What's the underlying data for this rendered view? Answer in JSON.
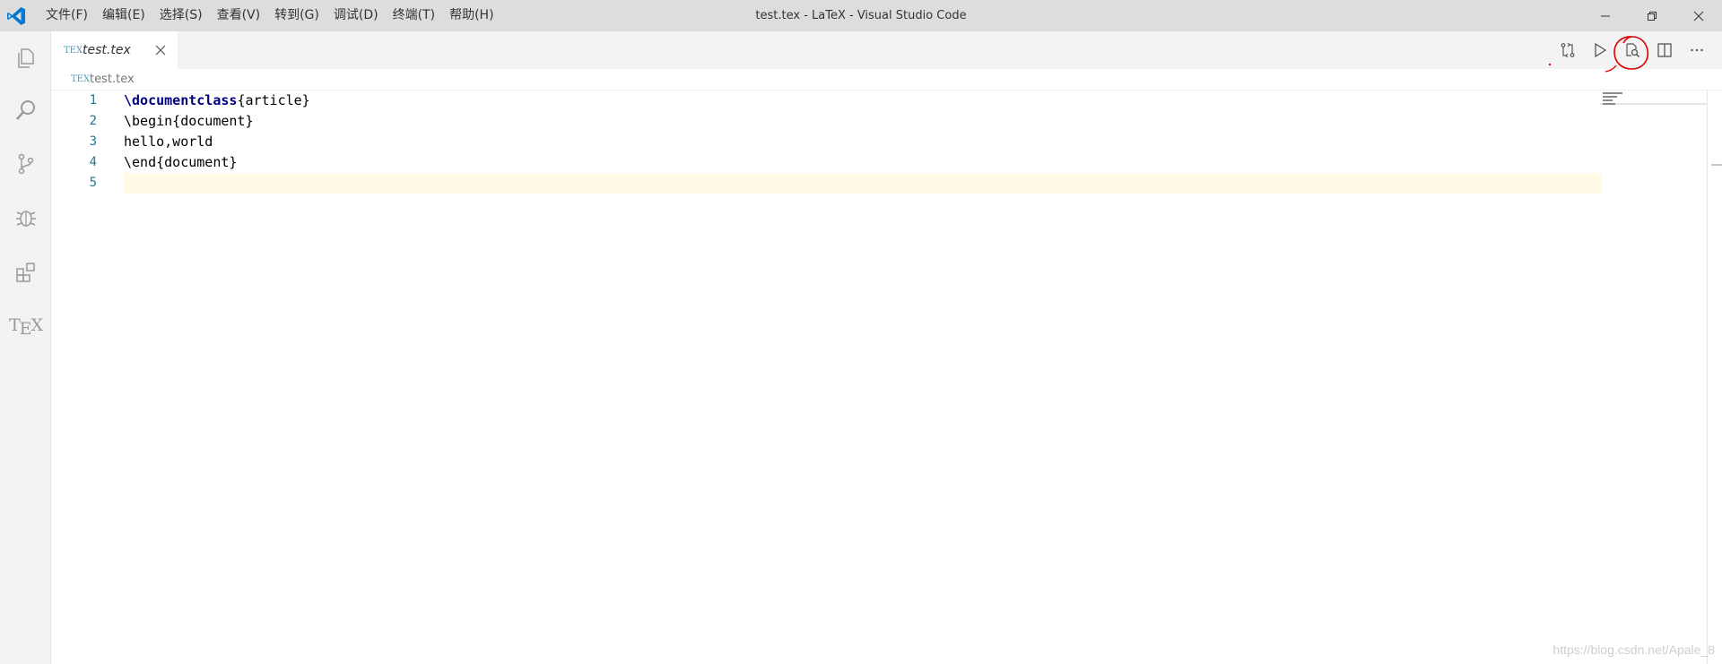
{
  "window": {
    "title": "test.tex - LaTeX - Visual Studio Code",
    "menu": [
      "文件(F)",
      "编辑(E)",
      "选择(S)",
      "查看(V)",
      "转到(G)",
      "调试(D)",
      "终端(T)",
      "帮助(H)"
    ],
    "controls": {
      "minimize_icon": "minimize-icon",
      "restore_icon": "restore-icon",
      "close_icon": "close-icon"
    }
  },
  "activity_bar": {
    "items": [
      "explorer-icon",
      "search-icon",
      "source-control-icon",
      "debug-icon",
      "extensions-icon",
      "tex-icon"
    ],
    "tex_label_t": "T",
    "tex_label_e": "E",
    "tex_label_x": "X"
  },
  "tabs": [
    {
      "label": "test.tex",
      "icon": "TEX"
    }
  ],
  "editor_actions": [
    "source-diff-icon",
    "run-icon",
    "preview-pdf-icon",
    "split-editor-icon",
    "more-actions-icon"
  ],
  "breadcrumb": {
    "label": "test.tex",
    "icon": "TEX"
  },
  "editor": {
    "line_numbers": [
      "1",
      "2",
      "3",
      "4",
      "5"
    ],
    "lines": [
      {
        "kw": "\\documentclass",
        "rest": "{article}"
      },
      {
        "kw": "",
        "rest": "\\begin{document}"
      },
      {
        "kw": "",
        "rest": "hello,world"
      },
      {
        "kw": "",
        "rest": "\\end{document}"
      },
      {
        "kw": "",
        "rest": ""
      }
    ]
  },
  "watermark": "https://blog.csdn.net/Apale_8",
  "colors": {
    "titlebar_bg": "#dddddd",
    "activity_bg": "#f3f3f3",
    "line_number": "#237893",
    "keyword": "#000080",
    "current_line": "#fffbe6",
    "annotation_red": "#dd0000"
  }
}
